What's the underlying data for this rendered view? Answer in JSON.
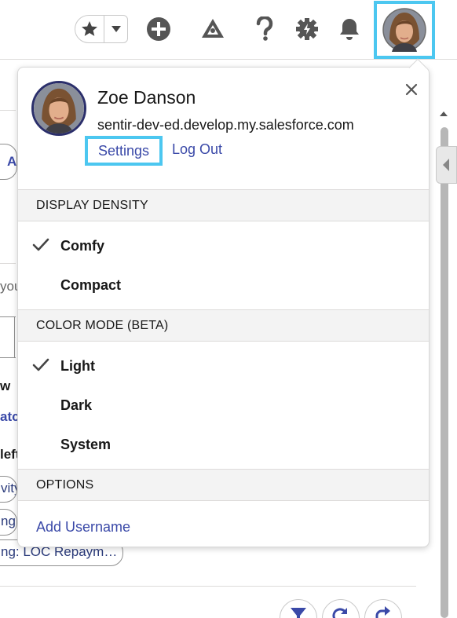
{
  "header": {
    "icons": {
      "favorites": "star-icon",
      "favorites_menu": "chevron-down-icon",
      "global_actions": "plus-circle-icon",
      "trailhead": "trailhead-icon",
      "help": "question-icon",
      "setup": "gear-icon",
      "notifications": "bell-icon"
    }
  },
  "background": {
    "fragments": [
      "A",
      "you",
      "w",
      "atcl",
      "left",
      "vity",
      "ng (",
      "ng: LOC Repaym…"
    ]
  },
  "user_menu": {
    "name": "Zoe Danson",
    "domain": "sentir-dev-ed.develop.my.salesforce.com",
    "settings_label": "Settings",
    "logout_label": "Log Out",
    "sections": {
      "density": {
        "title": "DISPLAY DENSITY",
        "options": [
          "Comfy",
          "Compact"
        ],
        "selected": "Comfy"
      },
      "color_mode": {
        "title": "COLOR MODE (BETA)",
        "options": [
          "Light",
          "Dark",
          "System"
        ],
        "selected": "Light"
      },
      "options": {
        "title": "OPTIONS",
        "add_username": "Add Username"
      }
    }
  },
  "colors": {
    "link": "#3a49a8",
    "highlight": "#4cc7f0",
    "section_bg": "#f3f3f3"
  }
}
